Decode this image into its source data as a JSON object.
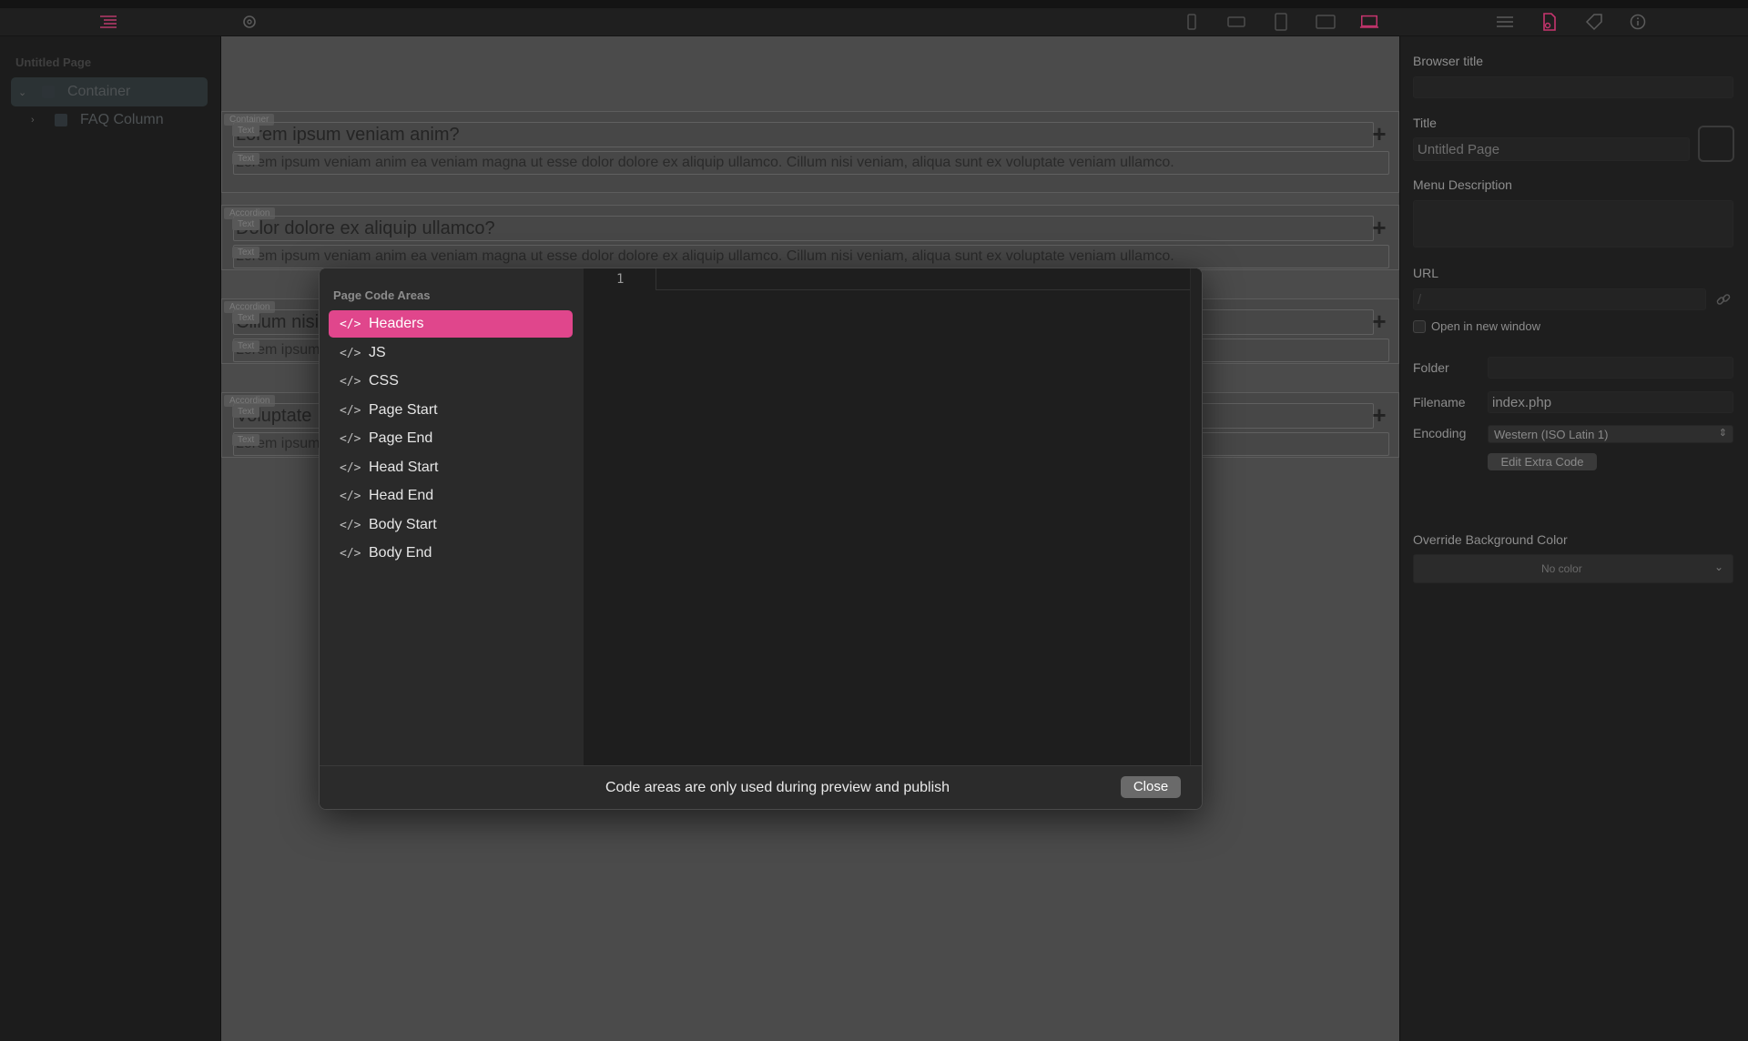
{
  "sidebar": {
    "title": "Untitled Page",
    "items": [
      {
        "label": "Container"
      },
      {
        "label": "FAQ Column"
      }
    ]
  },
  "canvas": {
    "blocks": [
      {
        "tag": "Container",
        "text_tags": [
          "Text",
          "Text"
        ],
        "question": "Lorem ipsum veniam anim?",
        "answer": "Lorem ipsum veniam anim ea veniam magna ut esse dolor dolore ex aliquip ullamco. Cillum nisi veniam, aliqua sunt ex voluptate veniam ullamco."
      },
      {
        "tag": "Accordion",
        "text_tags": [
          "Text",
          "Text"
        ],
        "question": "Dolor dolore ex aliquip ullamco?",
        "answer": "Lorem ipsum veniam anim ea veniam magna ut esse dolor dolore ex aliquip ullamco. Cillum nisi veniam, aliqua sunt ex voluptate veniam ullamco."
      },
      {
        "tag": "Accordion",
        "text_tags": [
          "Text",
          "Text"
        ],
        "question": "Cillum nisi",
        "answer": "Lorem ipsum"
      },
      {
        "tag": "Accordion",
        "text_tags": [
          "Text",
          "Text"
        ],
        "question": "Voluptate",
        "answer": "Lorem ipsum"
      }
    ]
  },
  "right_panel": {
    "browser_title_label": "Browser title",
    "title_label": "Title",
    "title_value": "Untitled Page",
    "menu_description_label": "Menu Description",
    "url_label": "URL",
    "url_value": "/",
    "open_new_window_label": "Open in new window",
    "folder_label": "Folder",
    "filename_label": "Filename",
    "filename_value": "index.php",
    "encoding_label": "Encoding",
    "encoding_value": "Western (ISO Latin 1)",
    "edit_extra_code_label": "Edit Extra Code",
    "override_bg_label": "Override Background Color",
    "no_color_label": "No color"
  },
  "modal": {
    "heading": "Page Code Areas",
    "items": [
      {
        "label": "Headers",
        "selected": true
      },
      {
        "label": "JS"
      },
      {
        "label": "CSS"
      },
      {
        "label": "Page Start"
      },
      {
        "label": "Page End"
      },
      {
        "label": "Head Start"
      },
      {
        "label": "Head End"
      },
      {
        "label": "Body Start"
      },
      {
        "label": "Body End"
      }
    ],
    "item_icon": "</>",
    "line_number": "1",
    "note": "Code areas are only used during preview and publish",
    "close_label": "Close"
  },
  "colors": {
    "accent": "#e0468c",
    "active_icon": "#c7356f"
  }
}
